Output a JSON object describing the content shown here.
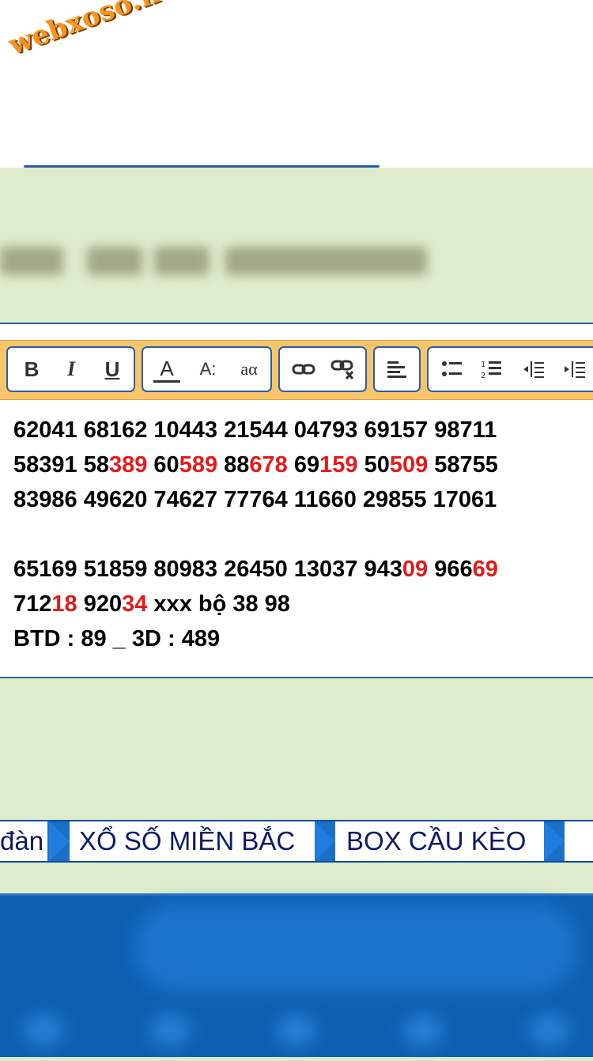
{
  "logo": {
    "text": "webxoso.net"
  },
  "toolbar": {
    "groups": [
      {
        "buttons": [
          {
            "name": "bold-button",
            "label": "B"
          },
          {
            "name": "italic-button",
            "label": "I"
          },
          {
            "name": "underline-button",
            "label": "U"
          }
        ]
      },
      {
        "buttons": [
          {
            "name": "font-color-button",
            "label": "A"
          },
          {
            "name": "font-size-button",
            "label": "A:"
          },
          {
            "name": "text-case-button",
            "label": "aα"
          }
        ]
      },
      {
        "buttons": [
          {
            "name": "insert-link-button",
            "icon": "link-icon"
          },
          {
            "name": "remove-link-button",
            "icon": "unlink-icon"
          }
        ]
      },
      {
        "buttons": [
          {
            "name": "align-left-button",
            "icon": "align-left-icon"
          }
        ]
      },
      {
        "buttons": [
          {
            "name": "bullet-list-button",
            "icon": "bullet-list-icon"
          },
          {
            "name": "numbered-list-button",
            "icon": "numbered-list-icon"
          },
          {
            "name": "outdent-button",
            "icon": "outdent-icon"
          },
          {
            "name": "indent-button",
            "icon": "indent-icon"
          }
        ]
      }
    ]
  },
  "editor": {
    "lines": [
      [
        {
          "t": "62041 68162 10443 21544 04793 69157 98711"
        }
      ],
      [
        {
          "t": "58391 58"
        },
        {
          "t": "389",
          "red": true
        },
        {
          "t": " 60"
        },
        {
          "t": "589",
          "red": true
        },
        {
          "t": " 88"
        },
        {
          "t": "678",
          "red": true
        },
        {
          "t": " 69"
        },
        {
          "t": "159",
          "red": true
        },
        {
          "t": " 50"
        },
        {
          "t": "509",
          "red": true
        },
        {
          "t": " 58755"
        }
      ],
      [
        {
          "t": "83986 49620 74627 77764 11660 29855 17061"
        }
      ],
      [
        {
          "t": ""
        }
      ],
      [
        {
          "t": "65169 51859 80983 26450 13037 943"
        },
        {
          "t": "09",
          "red": true
        },
        {
          "t": " 966"
        },
        {
          "t": "69",
          "red": true
        }
      ],
      [
        {
          "t": "712"
        },
        {
          "t": "18",
          "red": true
        },
        {
          "t": " 920"
        },
        {
          "t": "34",
          "red": true
        },
        {
          "t": " xxx bộ 38 98"
        }
      ],
      [
        {
          "t": "BTD : 89 _ 3D : 489"
        }
      ]
    ]
  },
  "nav": {
    "items": [
      {
        "label": "đàn"
      },
      {
        "label": "XỔ SỐ MIỀN BẮC"
      },
      {
        "label": "BOX CẦU KÈO"
      }
    ]
  },
  "colors": {
    "accent_blue": "#2a5da8",
    "highlight_red": "#e31b1b",
    "panel_green": "#dfeccb",
    "toolbar_orange": "#f7c66a"
  }
}
